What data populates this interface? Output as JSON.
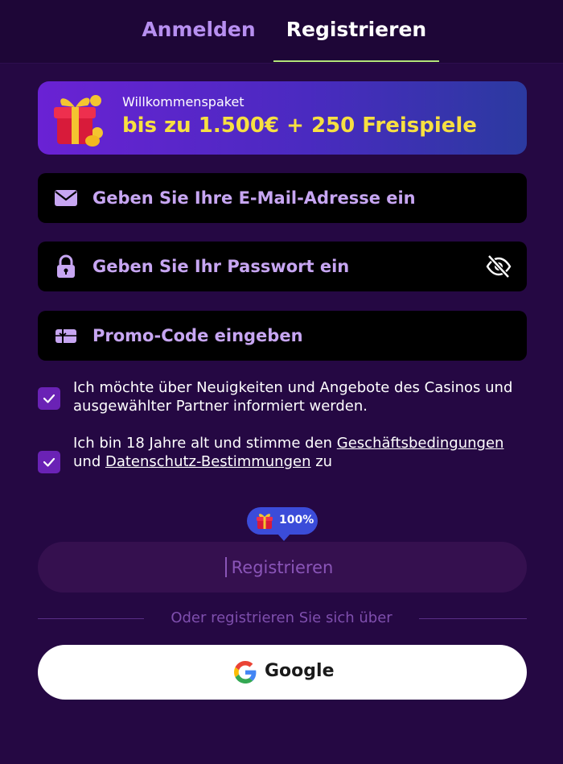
{
  "tabs": {
    "login": "Anmelden",
    "register": "Registrieren"
  },
  "promo": {
    "subtitle": "Willkommenspaket",
    "title": "bis zu 1.500€ + 250 Freispiele"
  },
  "fields": {
    "email_placeholder": "Geben Sie Ihre E-Mail-Adresse ein",
    "password_placeholder": "Geben Sie Ihr Passwort ein",
    "promo_placeholder": "Promo-Code eingeben"
  },
  "checkboxes": {
    "newsletter": {
      "checked": true,
      "text": "Ich möchte über Neuigkeiten und Angebote des Casinos und ausgewählter Partner informiert werden."
    },
    "terms": {
      "checked": true,
      "text_before": "Ich bin 18 Jahre alt und stimme den ",
      "terms_link": "Geschäftsbedingungen",
      "text_middle": " und ",
      "privacy_link": "Datenschutz-Bestimmungen",
      "text_after": " zu"
    }
  },
  "bonus_badge": {
    "percent": "100%"
  },
  "register_button": "Registrieren",
  "divider_text": "Oder registrieren Sie sich über",
  "google_button": "Google",
  "colors": {
    "background": "#250843",
    "accent_yellow": "#f7e041",
    "tab_inactive": "#b78ff0",
    "tab_underline": "#b3e37a",
    "checkbox": "#6a22b5"
  },
  "icons": {
    "email": "envelope-icon",
    "password": "lock-icon",
    "promo": "ticket-icon",
    "toggle": "eye-off-icon",
    "gift": "gift-icon",
    "google": "google-icon",
    "check": "checkmark-icon"
  }
}
